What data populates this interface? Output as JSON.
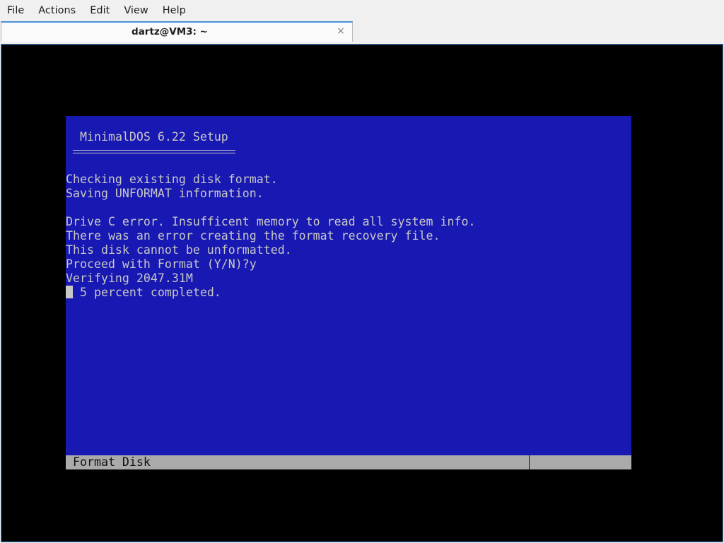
{
  "menubar": {
    "items": [
      "File",
      "Actions",
      "Edit",
      "View",
      "Help"
    ]
  },
  "tab": {
    "title": "dartz@VM3: ~",
    "close_glyph": "×",
    "close_icon": "close-icon"
  },
  "colors": {
    "accent": "#4a90d9",
    "dos_background": "#1818b2",
    "dos_text": "#c8c8c8",
    "status_bar": "#aaaaaa",
    "terminal_background": "#000000"
  },
  "dos": {
    "title": "MinimalDOS 6.22 Setup",
    "lines": [
      "Checking existing disk format.",
      "Saving UNFORMAT information.",
      "",
      "Drive C error. Insufficent memory to read all system info.",
      "There was an error creating the format recovery file.",
      "This disk cannot be unformatted.",
      "Proceed with Format (Y/N)?y",
      "Verifying 2047.31M"
    ],
    "progress_text": " 5 percent completed.",
    "status_label": "Format Disk"
  }
}
